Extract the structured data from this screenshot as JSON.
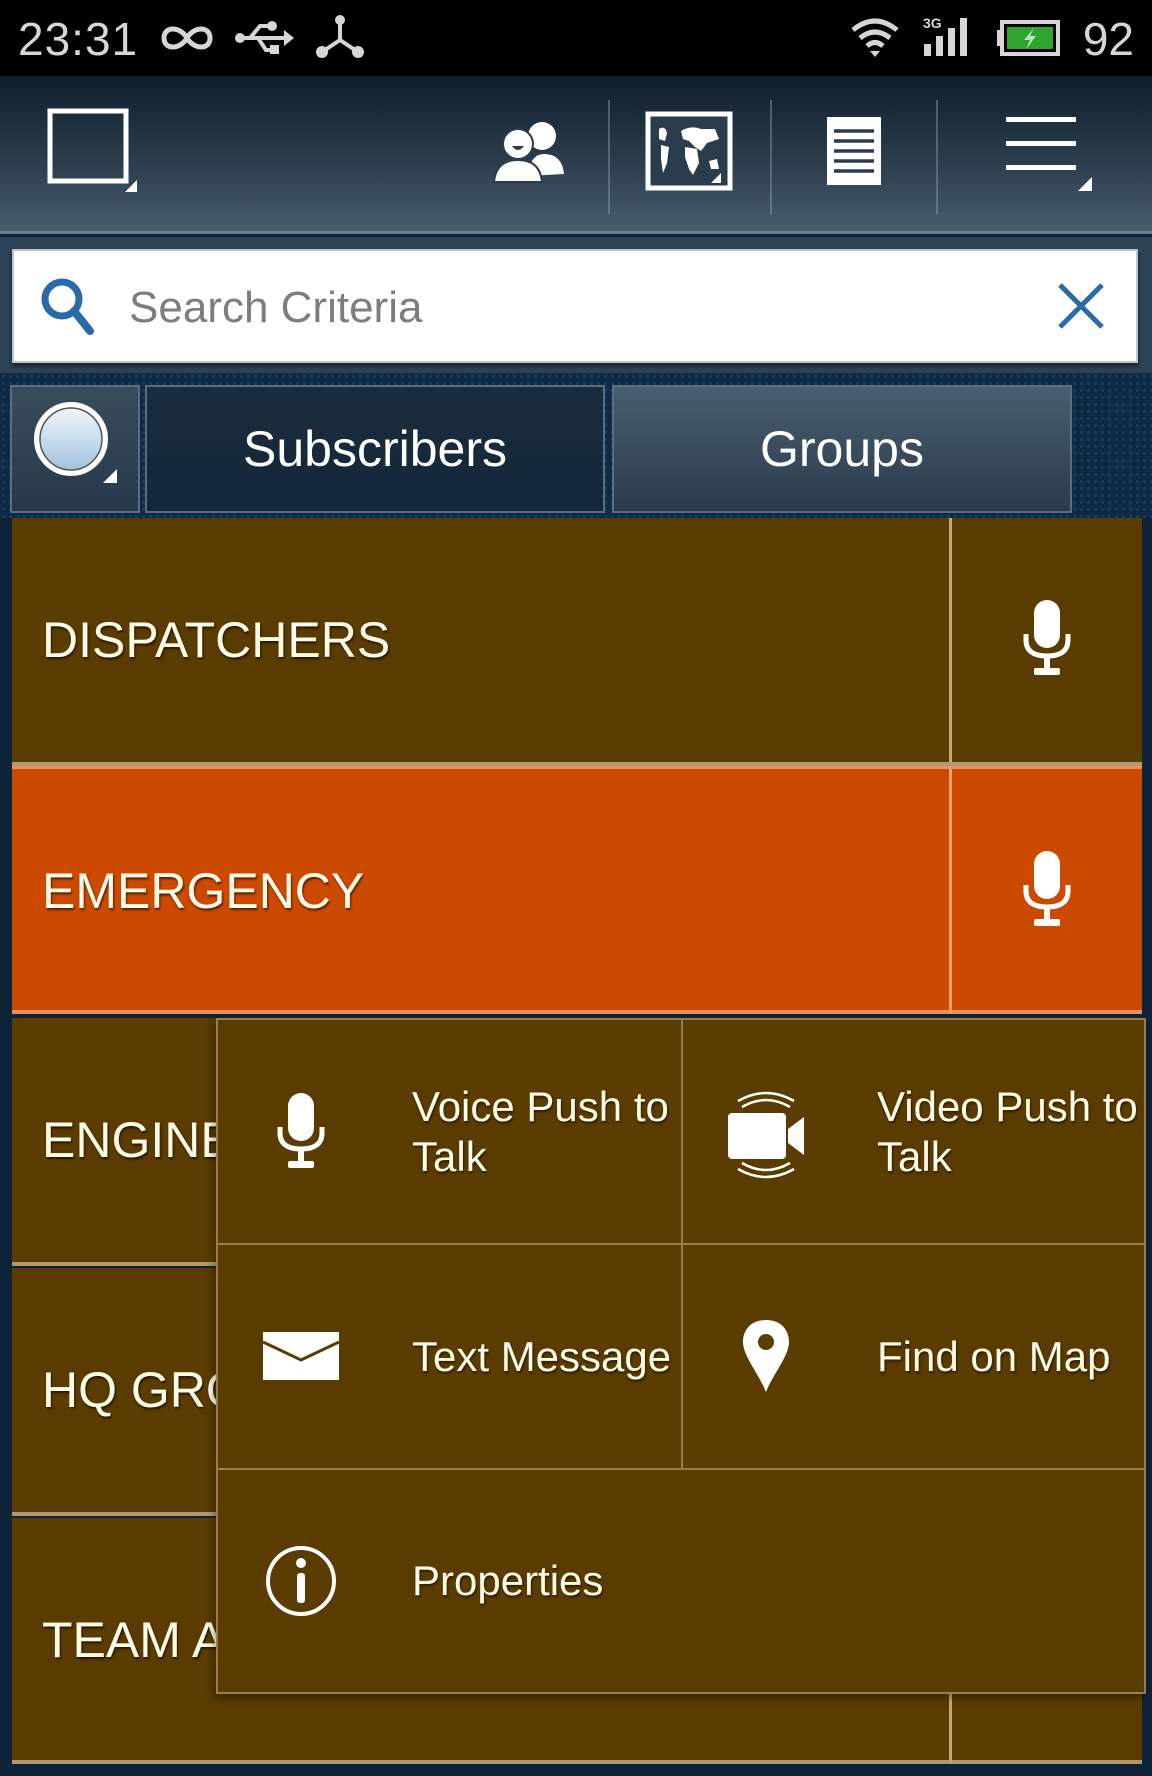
{
  "status_bar": {
    "time": "23:31",
    "icons": [
      "infinity-icon",
      "usb-icon",
      "share-icon",
      "wifi-icon",
      "signal-3g-icon",
      "battery-charging-icon"
    ],
    "network_type": "3G",
    "battery_percent": "92",
    "battery_color": "#2fa52f"
  },
  "toolbar": {
    "buttons": [
      {
        "name": "window-select",
        "icon": "square-window-icon"
      },
      {
        "name": "contacts",
        "icon": "contacts-icon"
      },
      {
        "name": "map",
        "icon": "world-map-icon"
      },
      {
        "name": "list",
        "icon": "document-list-icon"
      },
      {
        "name": "menu",
        "icon": "hamburger-menu-icon"
      }
    ]
  },
  "search": {
    "placeholder": "Search Criteria",
    "value": "",
    "accent": "#2a6aa8"
  },
  "tabs": {
    "filter_icon": "status-circle-icon",
    "items": [
      {
        "label": "Subscribers",
        "selected": true
      },
      {
        "label": "Groups",
        "selected": false
      }
    ]
  },
  "groups": [
    {
      "name": "DISPATCHERS",
      "color": "#5a3c00"
    },
    {
      "name": "EMERGENCY",
      "color": "#cc4a00"
    },
    {
      "name": "ENGINEERING",
      "color": "#5a3c00"
    },
    {
      "name": "HQ GROUP",
      "color": "#5a3c00"
    },
    {
      "name": "TEAM A",
      "color": "#5a3c00"
    }
  ],
  "context_menu": {
    "items": [
      {
        "label": "Voice Push to Talk",
        "line1": "Voice Push to",
        "line2": "Talk",
        "icon": "microphone-icon"
      },
      {
        "label": "Video Push to Talk",
        "line1": "Video Push to",
        "line2": "Talk",
        "icon": "video-camera-icon"
      },
      {
        "label": "Text Message",
        "icon": "envelope-icon"
      },
      {
        "label": "Find on Map",
        "icon": "map-pin-icon"
      },
      {
        "label": "Properties",
        "icon": "info-icon"
      }
    ]
  }
}
